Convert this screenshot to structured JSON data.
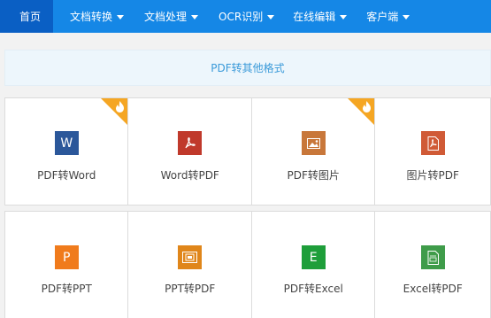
{
  "nav": {
    "items": [
      {
        "label": "首页",
        "active": true,
        "dropdown": false
      },
      {
        "label": "文档转换",
        "active": false,
        "dropdown": true
      },
      {
        "label": "文档处理",
        "active": false,
        "dropdown": true
      },
      {
        "label": "OCR识别",
        "active": false,
        "dropdown": true
      },
      {
        "label": "在线编辑",
        "active": false,
        "dropdown": true
      },
      {
        "label": "客户端",
        "active": false,
        "dropdown": true
      }
    ]
  },
  "banner": {
    "label": "PDF转其他格式"
  },
  "tools": [
    {
      "label": "PDF转Word",
      "icon": "word-icon",
      "glyph": "W",
      "color": "#2b579a",
      "hot": true
    },
    {
      "label": "Word转PDF",
      "icon": "pdf-icon",
      "glyph": "",
      "color": "#c0392b",
      "hot": false
    },
    {
      "label": "PDF转图片",
      "icon": "image-icon",
      "glyph": "",
      "color": "#c8773a",
      "hot": true
    },
    {
      "label": "图片转PDF",
      "icon": "pdf-icon",
      "glyph": "",
      "color": "#d05a36",
      "hot": false
    },
    {
      "label": "PDF转PPT",
      "icon": "ppt-icon",
      "glyph": "P",
      "color": "#f07b1c",
      "hot": false
    },
    {
      "label": "PPT转PDF",
      "icon": "ppt-pdf-icon",
      "glyph": "",
      "color": "#e0861a",
      "hot": false
    },
    {
      "label": "PDF转Excel",
      "icon": "excel-icon",
      "glyph": "E",
      "color": "#1e9e3a",
      "hot": false
    },
    {
      "label": "Excel转PDF",
      "icon": "pdf-doc-icon",
      "glyph": "",
      "color": "#3f9c4a",
      "hot": false
    }
  ]
}
